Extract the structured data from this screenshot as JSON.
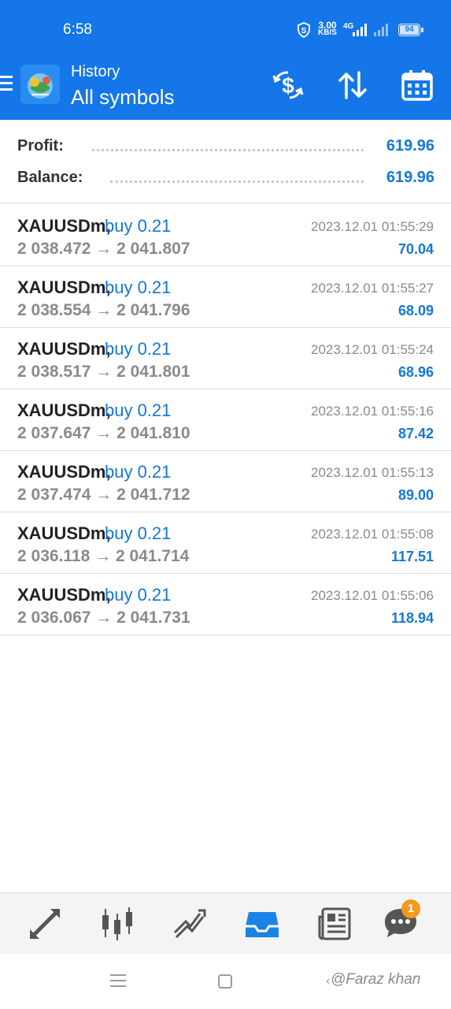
{
  "status_bar": {
    "time": "6:58",
    "speed_value": "3.00",
    "speed_unit": "KB/S",
    "network": "4G",
    "battery": "94"
  },
  "header": {
    "title": "History",
    "subtitle": "All symbols",
    "icons": [
      "menu-icon",
      "app-logo",
      "currency-exchange-icon",
      "sort-icon",
      "calendar-icon"
    ]
  },
  "summary": {
    "profit_label": "Profit:",
    "profit_value": "619.96",
    "balance_label": "Balance:",
    "balance_value": "619.96"
  },
  "deals": [
    {
      "symbol": "XAUUSDm,",
      "type": "buy 0.21",
      "open": "2 038.472",
      "close": "2 041.807",
      "time": "2023.12.01 01:55:29",
      "profit": "70.04"
    },
    {
      "symbol": "XAUUSDm,",
      "type": "buy 0.21",
      "open": "2 038.554",
      "close": "2 041.796",
      "time": "2023.12.01 01:55:27",
      "profit": "68.09"
    },
    {
      "symbol": "XAUUSDm,",
      "type": "buy 0.21",
      "open": "2 038.517",
      "close": "2 041.801",
      "time": "2023.12.01 01:55:24",
      "profit": "68.96"
    },
    {
      "symbol": "XAUUSDm,",
      "type": "buy 0.21",
      "open": "2 037.647",
      "close": "2 041.810",
      "time": "2023.12.01 01:55:16",
      "profit": "87.42"
    },
    {
      "symbol": "XAUUSDm,",
      "type": "buy 0.21",
      "open": "2 037.474",
      "close": "2 041.712",
      "time": "2023.12.01 01:55:13",
      "profit": "89.00"
    },
    {
      "symbol": "XAUUSDm,",
      "type": "buy 0.21",
      "open": "2 036.118",
      "close": "2 041.714",
      "time": "2023.12.01 01:55:08",
      "profit": "117.51"
    },
    {
      "symbol": "XAUUSDm,",
      "type": "buy 0.21",
      "open": "2 036.067",
      "close": "2 041.731",
      "time": "2023.12.01 01:55:06",
      "profit": "118.94"
    }
  ],
  "bottom_nav": {
    "items": [
      "quotes-icon",
      "chart-icon",
      "trade-icon",
      "history-icon",
      "news-icon",
      "chat-icon"
    ],
    "active": "history-icon",
    "chat_badge": "1"
  },
  "system_nav": {
    "watermark": "@Faraz khan"
  },
  "colors": {
    "header_bg": "#1476e8",
    "accent_blue": "#1478d6",
    "muted_gray": "#8a8a8a",
    "badge_orange": "#f39a1e"
  }
}
